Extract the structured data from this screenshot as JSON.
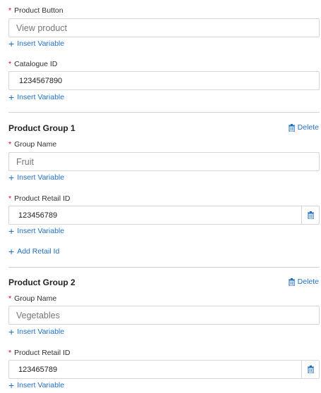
{
  "product_button": {
    "label": "Product Button",
    "value": "View product",
    "insert_variable": "Insert Variable"
  },
  "catalogue": {
    "label": "Catalogue ID",
    "value": "1234567890",
    "insert_variable": "Insert Variable"
  },
  "groups": [
    {
      "title": "Product Group 1",
      "delete_label": "Delete",
      "group_name_label": "Group Name",
      "group_name_value": "Fruit",
      "group_name_insert_variable": "Insert Variable",
      "retail_label": "Product Retail ID",
      "retail_value": "123456789",
      "retail_insert_variable": "Insert Variable",
      "add_retail_label": "Add Retail Id"
    },
    {
      "title": "Product Group 2",
      "delete_label": "Delete",
      "group_name_label": "Group Name",
      "group_name_value": "Vegetables",
      "group_name_insert_variable": "Insert Variable",
      "retail_label": "Product Retail ID",
      "retail_value": "123465789",
      "retail_insert_variable": "Insert Variable"
    }
  ],
  "required_marker": "*",
  "plus_glyph": "+",
  "colors": {
    "link": "#1f6fc0",
    "required": "#d0021b",
    "border": "#d6d6d6"
  },
  "icons": {
    "delete": "trash-icon",
    "add": "plus-icon"
  }
}
